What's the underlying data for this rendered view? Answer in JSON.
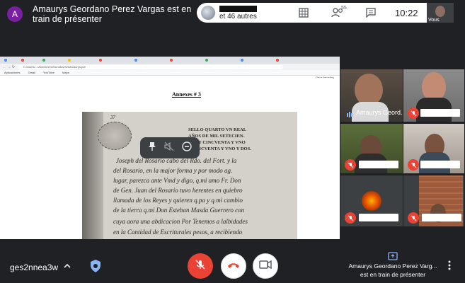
{
  "presenter": {
    "avatar_letter": "A",
    "banner_text": "Amaurys Geordano Perez Vargas est en train de présenter"
  },
  "participants": {
    "others_text": "et 46 autres",
    "count_badge": "55"
  },
  "clock": "10:22",
  "self_tile": {
    "label": "Vous"
  },
  "shared_screen": {
    "address": "C:/Users/.../Annexes%20Unidos%20Amaurys.pdf",
    "bookmarks": [
      "Aplicaciones",
      "Gmail",
      "YouTube",
      "Maps"
    ],
    "bookmarks_right": "Otros favoritos",
    "annex_title": "Annexes # 3",
    "manuscript_lines": [
      "37",
      "SELLO QUARTO VN REAL",
      "AÑOS DE MIL SETECIEN-",
      "TOS Y CINCVENTA Y VNO",
      "Y CINCVENTA Y VNO Y DOS.",
      "Joseph del Rosario cabo del Rdo. del Fort. y la",
      "del Rosario, en la major forma y por modo ag.",
      "lugar, parezca ante Vmd y digo, q.mi amo Fr. Don",
      "de Gen. Juan del Rosario tuvo herentes en quiebro",
      "llamada de los Reyes y quieren q.pa y q.mi cambio",
      "de la tierra q.mi Don Esteban Masda Guerrero con",
      "cuya aora una abdicacion Por Tenemos a lalbidades",
      "en la Cantidad de Escriturales pesos, a recibiendo"
    ]
  },
  "tiles": [
    {
      "label": "Amaurys Geord..."
    }
  ],
  "bottom": {
    "meeting_code": "ges2nnea3w",
    "present_line1": "Amaurys Geordano Perez Varg...",
    "present_line2": "est en train de présenter"
  },
  "colors": {
    "background": "#202124",
    "tile": "#3c4043",
    "danger": "#ea4335",
    "avatar": "#7b1fa2"
  },
  "icons": [
    "grid-layout-icon",
    "people-icon",
    "chat-icon",
    "pin-icon",
    "mute-audio-icon",
    "remove-icon",
    "mic-off-icon",
    "hang-up-icon",
    "camera-icon",
    "chevron-up-icon",
    "shield-icon",
    "present-icon",
    "more-vert-icon"
  ]
}
